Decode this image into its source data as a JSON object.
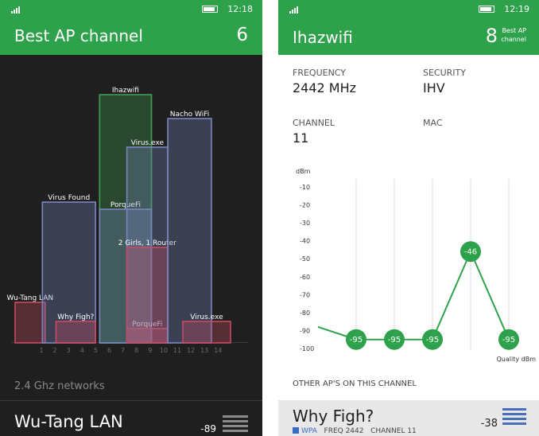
{
  "left": {
    "status_time": "12:18",
    "header_title": "Best AP channel",
    "header_value": "6",
    "section_caption": "2.4 Ghz networks",
    "row": {
      "name": "Wu-Tang LAN",
      "signal": "-89"
    }
  },
  "right": {
    "status_time": "12:19",
    "header_title": "Ihazwifi",
    "best_value": "8",
    "best_label_1": "Best AP",
    "best_label_2": "channel",
    "fields": {
      "frequency_label": "FREQUENCY",
      "frequency_value": "2442 MHz",
      "security_label": "SECURITY",
      "security_value": "IHV",
      "channel_label": "CHANNEL",
      "channel_value": "11",
      "mac_label": "MAC"
    },
    "other_caption": "OTHER AP'S ON THIS CHANNEL",
    "other_ap": {
      "name": "Why Figh?",
      "security": "WPA",
      "freq": "FREQ 2442",
      "channel": "CHANNEL 11",
      "signal": "-38"
    }
  },
  "chart_data": [
    {
      "type": "bar",
      "description_series": "channel-spanning network footprints",
      "x_ticks": [
        "1",
        "2",
        "3",
        "4",
        "5",
        "6",
        "7",
        "8",
        "9",
        "10",
        "11",
        "12",
        "13",
        "14"
      ],
      "networks": [
        {
          "name": "Wu-Tang LAN",
          "ch_start": 0.0,
          "ch_end": 2.2,
          "level": 0.85,
          "color": "#c94a60"
        },
        {
          "name": "Virus Found",
          "ch_start": 2.0,
          "ch_end": 5.9,
          "level": 2.95,
          "color": "#7a86c0"
        },
        {
          "name": "Why Figh?",
          "ch_start": 3.0,
          "ch_end": 5.9,
          "level": 0.45,
          "color": "#c94a60"
        },
        {
          "name": "Ihazwifi",
          "ch_start": 6.2,
          "ch_end": 10.0,
          "level": 5.2,
          "color": "#3fa050"
        },
        {
          "name": "PorqueFi",
          "ch_start": 6.2,
          "ch_end": 10.0,
          "level": 2.8,
          "color": "#7a86c0"
        },
        {
          "name": "PorqueFi",
          "ch_start": 8.2,
          "ch_end": 11.2,
          "level": 0.3,
          "color": "#c94a60"
        },
        {
          "name": "Virus.exe",
          "ch_start": 8.2,
          "ch_end": 11.2,
          "level": 4.1,
          "color": "#7a86c0"
        },
        {
          "name": "2 Girls, 1 Router",
          "ch_start": 8.2,
          "ch_end": 11.2,
          "level": 2.0,
          "color": "#c94a60"
        },
        {
          "name": "Nacho WiFi",
          "ch_start": 11.2,
          "ch_end": 14.4,
          "level": 4.7,
          "color": "#7a86c0"
        },
        {
          "name": "Virus.exe",
          "ch_start": 12.3,
          "ch_end": 15.8,
          "level": 0.45,
          "color": "#c94a60"
        }
      ]
    },
    {
      "type": "line",
      "ylabel": "dBm",
      "y_ticks": [
        "-10",
        "-20",
        "-30",
        "-40",
        "-50",
        "-60",
        "-70",
        "-80",
        "-90",
        "-100"
      ],
      "ylim": [
        -100,
        -10
      ],
      "x_label": "Quality dBm",
      "points": [
        -95,
        -95,
        -95,
        -46,
        -95
      ],
      "point_labels": [
        "-95",
        "-95",
        "-95",
        "-46",
        "-95"
      ],
      "lead_in": -88,
      "color": "#2ea24a"
    }
  ]
}
